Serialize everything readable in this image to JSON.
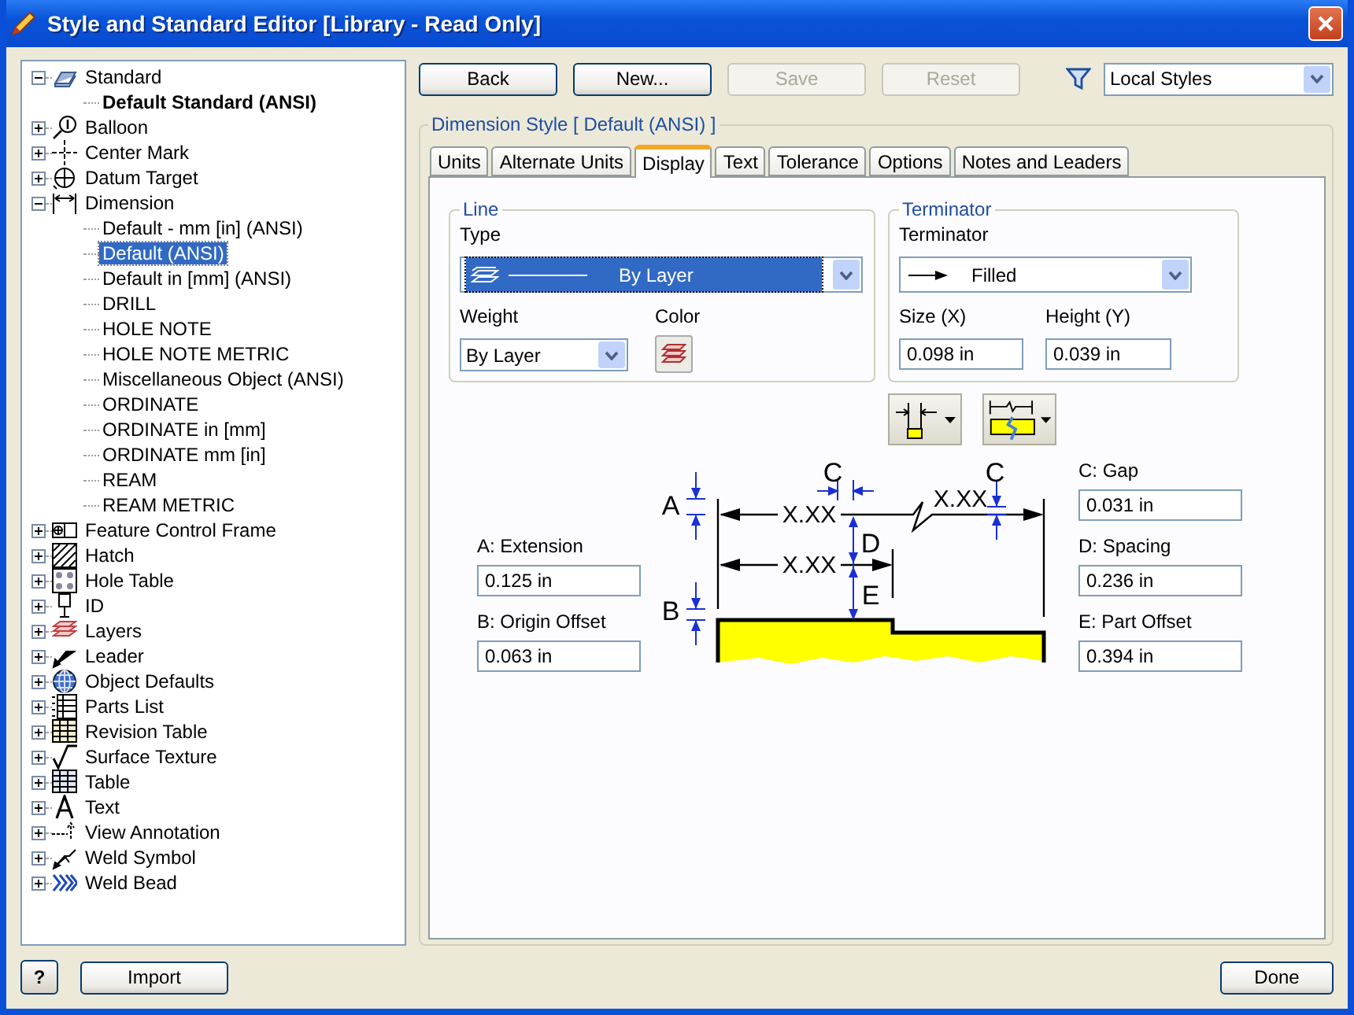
{
  "window": {
    "title": "Style and Standard Editor [Library - Read Only]"
  },
  "tree": {
    "items": [
      {
        "label": "Standard",
        "expanded": true,
        "children": [
          {
            "label": "Default Standard (ANSI)",
            "active": true,
            "selected": false
          }
        ]
      },
      {
        "label": "Balloon",
        "expanded": false
      },
      {
        "label": "Center Mark",
        "expanded": false
      },
      {
        "label": "Datum Target",
        "expanded": false
      },
      {
        "label": "Dimension",
        "expanded": true,
        "children": [
          {
            "label": "Default - mm [in] (ANSI)",
            "active": false,
            "selected": false
          },
          {
            "label": "Default (ANSI)",
            "active": false,
            "selected": true
          },
          {
            "label": "Default in [mm] (ANSI)",
            "active": false,
            "selected": false
          },
          {
            "label": "DRILL",
            "active": false,
            "selected": false
          },
          {
            "label": "HOLE NOTE",
            "active": false,
            "selected": false
          },
          {
            "label": "HOLE NOTE METRIC",
            "active": false,
            "selected": false
          },
          {
            "label": "Miscellaneous Object (ANSI)",
            "active": false,
            "selected": false
          },
          {
            "label": "ORDINATE",
            "active": false,
            "selected": false
          },
          {
            "label": "ORDINATE in [mm]",
            "active": false,
            "selected": false
          },
          {
            "label": "ORDINATE mm [in]",
            "active": false,
            "selected": false
          },
          {
            "label": "REAM",
            "active": false,
            "selected": false
          },
          {
            "label": "REAM METRIC",
            "active": false,
            "selected": false
          }
        ]
      },
      {
        "label": "Feature Control Frame",
        "expanded": false
      },
      {
        "label": "Hatch",
        "expanded": false
      },
      {
        "label": "Hole Table",
        "expanded": false
      },
      {
        "label": "ID",
        "expanded": false
      },
      {
        "label": "Layers",
        "expanded": false
      },
      {
        "label": "Leader",
        "expanded": false
      },
      {
        "label": "Object Defaults",
        "expanded": false
      },
      {
        "label": "Parts List",
        "expanded": false
      },
      {
        "label": "Revision Table",
        "expanded": false
      },
      {
        "label": "Surface Texture",
        "expanded": false
      },
      {
        "label": "Table",
        "expanded": false
      },
      {
        "label": "Text",
        "expanded": false
      },
      {
        "label": "View Annotation",
        "expanded": false
      },
      {
        "label": "Weld Symbol",
        "expanded": false
      },
      {
        "label": "Weld Bead",
        "expanded": false
      }
    ]
  },
  "toolbar": {
    "buttons": [
      {
        "label": "Back",
        "disabled": false
      },
      {
        "label": "New...",
        "disabled": false
      },
      {
        "label": "Save",
        "disabled": true
      },
      {
        "label": "Reset",
        "disabled": true
      }
    ],
    "filter": {
      "value": "Local Styles"
    }
  },
  "style_panel": {
    "title": "Dimension Style [ Default (ANSI) ]",
    "tabs": [
      {
        "label": "Units",
        "selected": false
      },
      {
        "label": "Alternate Units",
        "selected": false
      },
      {
        "label": "Display",
        "selected": true
      },
      {
        "label": "Text",
        "selected": false
      },
      {
        "label": "Tolerance",
        "selected": false
      },
      {
        "label": "Options",
        "selected": false
      },
      {
        "label": "Notes and Leaders",
        "selected": false
      }
    ],
    "line": {
      "title": "Line",
      "type_label": "Type",
      "type_value": "By Layer",
      "weight_label": "Weight",
      "weight_value": "By Layer",
      "color_label": "Color"
    },
    "terminator": {
      "title": "Terminator",
      "label": "Terminator",
      "value": "Filled",
      "size_label": "Size (X)",
      "size_value": "0.098 in",
      "height_label": "Height (Y)",
      "height_value": "0.039 in"
    },
    "diagram": {
      "labels": [
        "A",
        "B",
        "C",
        "C",
        "D",
        "E",
        "X.XX",
        "X.XX",
        "X.XX"
      ]
    },
    "left_fields": [
      {
        "label": "A: Extension",
        "value": "0.125 in"
      },
      {
        "label": "B: Origin Offset",
        "value": "0.063 in"
      }
    ],
    "right_fields": [
      {
        "label": "C: Gap",
        "value": "0.031 in"
      },
      {
        "label": "D: Spacing",
        "value": "0.236 in"
      },
      {
        "label": "E: Part Offset",
        "value": "0.394 in"
      }
    ]
  },
  "footer": {
    "help": "?",
    "import": "Import",
    "done": "Done"
  }
}
